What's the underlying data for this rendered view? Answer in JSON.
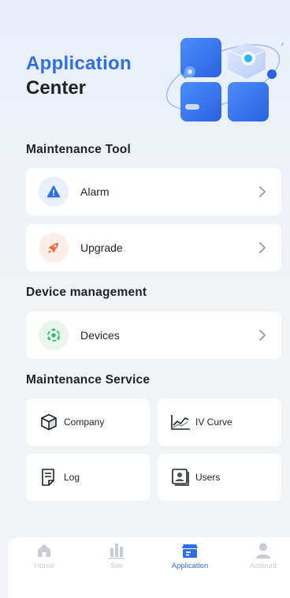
{
  "header": {
    "title_accent": "Application",
    "title_main": "Center"
  },
  "sections": {
    "maintenance_tool": "Maintenance Tool",
    "device_management": "Device management",
    "maintenance_service": "Maintenance Service"
  },
  "maintenance_tool_items": [
    {
      "label": "Alarm",
      "icon": "alarm-warning-icon"
    },
    {
      "label": "Upgrade",
      "icon": "rocket-icon"
    }
  ],
  "device_management_items": [
    {
      "label": "Devices",
      "icon": "devices-icon"
    }
  ],
  "maintenance_service_items": [
    {
      "label": "Company",
      "icon": "cube-icon"
    },
    {
      "label": "IV Curve",
      "icon": "chart-curve-icon"
    },
    {
      "label": "Log",
      "icon": "document-icon"
    },
    {
      "label": "Users",
      "icon": "user-card-icon"
    }
  ],
  "tabbar": {
    "tabs": [
      {
        "label": "Home",
        "icon": "home-icon",
        "active": false
      },
      {
        "label": "Site",
        "icon": "bar-chart-icon",
        "active": false
      },
      {
        "label": "Application",
        "icon": "application-box-icon",
        "active": true
      },
      {
        "label": "Account",
        "icon": "person-icon",
        "active": false
      }
    ]
  },
  "colors": {
    "accent": "#2f6fe4",
    "alarm_icon_bg": "#e9f0fd",
    "upgrade_icon_bg": "#fdeee8",
    "upgrade_icon": "#f26b3a",
    "devices_icon_bg": "#e8f6ee",
    "devices_icon": "#2bb56b",
    "inactive_tab": "#c9ccd2"
  }
}
